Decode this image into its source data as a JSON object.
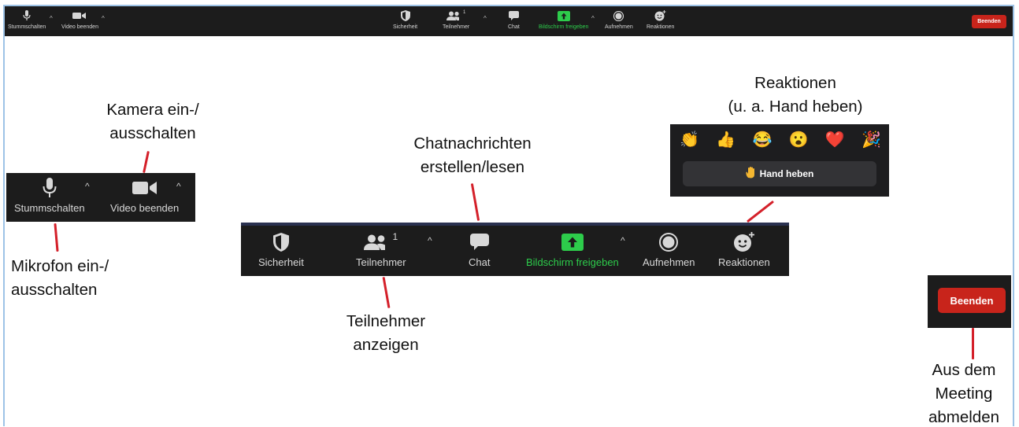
{
  "topbar": {
    "mute_label": "Stummschalten",
    "video_label": "Video beenden",
    "security_label": "Sicherheit",
    "participants_label": "Teilnehmer",
    "participants_count": "1",
    "chat_label": "Chat",
    "share_label": "Bildschirm freigeben",
    "record_label": "Aufnehmen",
    "reactions_label": "Reaktionen",
    "end_label": "Beenden"
  },
  "leftbar": {
    "mute_label": "Stummschalten",
    "video_label": "Video beenden"
  },
  "midbar": {
    "security_label": "Sicherheit",
    "participants_label": "Teilnehmer",
    "participants_count": "1",
    "chat_label": "Chat",
    "share_label": "Bildschirm freigeben",
    "record_label": "Aufnehmen",
    "reactions_label": "Reaktionen"
  },
  "reactions_popup": {
    "emojis": [
      "👏",
      "👍",
      "😂",
      "😮",
      "❤️",
      "🎉"
    ],
    "raise_hand_label": "Hand heben"
  },
  "end_button": {
    "label": "Beenden"
  },
  "annotations": {
    "camera": [
      "Kamera ein-/",
      "ausschalten"
    ],
    "microphone": [
      "Mikrofon ein-/",
      "ausschalten"
    ],
    "chat": [
      "Chatnachrichten",
      "erstellen/lesen"
    ],
    "participants": [
      "Teilnehmer",
      "anzeigen"
    ],
    "reactions": [
      "Reaktionen",
      "(u. a. Hand heben)"
    ],
    "leave": [
      "Aus dem",
      "Meeting",
      "abmelden"
    ]
  },
  "colors": {
    "toolbar_bg": "#1c1c1c",
    "share_green": "#2dcc4b",
    "end_red": "#c8241b",
    "pointer_red": "#d4202a",
    "frame_blue": "#9dc3e6"
  }
}
